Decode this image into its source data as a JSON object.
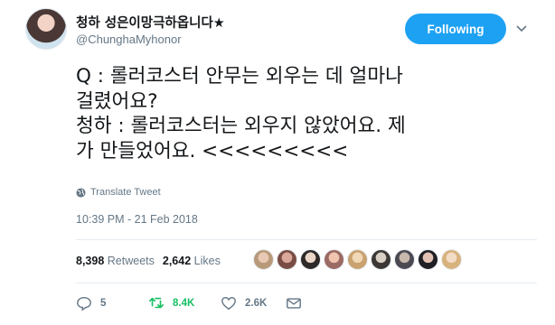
{
  "author": {
    "display_name": "청하 성은이망극하옵니다★",
    "handle": "@ChunghaMyhonor"
  },
  "follow_button_label": "Following",
  "tweet": {
    "text": "Q : 롤러코스터 안무는 외우는 데 얼마나\n걸렸어요?\n청하 : 롤러코스터는 외우지 않았어요. 제\n가 만들었어요. <<<<<<<<<",
    "translate_label": "Translate Tweet",
    "timestamp": "10:39 PM - 21 Feb 2018"
  },
  "stats": {
    "retweets_count": "8,398",
    "retweets_label": "Retweets",
    "likes_count": "2,642",
    "likes_label": "Likes"
  },
  "actions": {
    "reply_count": "5",
    "retweet_count": "8.4K",
    "like_count": "2.6K"
  },
  "colors": {
    "accent": "#1da1f2",
    "retweet_green": "#17bf63",
    "muted": "#657786"
  }
}
